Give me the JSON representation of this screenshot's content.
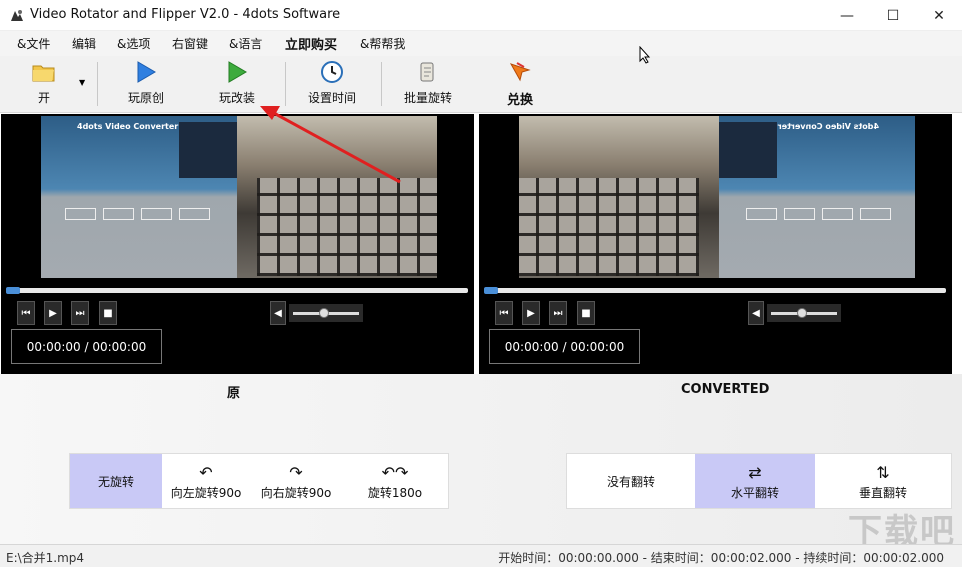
{
  "window": {
    "title": "Video Rotator and Flipper V2.0 - 4dots Software",
    "controls": {
      "minimize": "—",
      "maximize": "☐",
      "close": "✕"
    }
  },
  "menu": [
    {
      "label": "&文件"
    },
    {
      "label": "编辑"
    },
    {
      "label": "&选项"
    },
    {
      "label": "右窗键"
    },
    {
      "label": "&语言"
    },
    {
      "label": "立即购买"
    },
    {
      "label": "&帮帮我"
    }
  ],
  "toolbar": {
    "open_label": "开",
    "play_original_label": "玩原创",
    "play_converted_label": "玩改装",
    "set_time_label": "设置时间",
    "batch_rotate_label": "批量旋转",
    "convert_label": "兑换"
  },
  "players": {
    "original": {
      "time": "00:00:00 / 00:00:00",
      "caption": "原",
      "seek_progress": 0.0,
      "volume": 0.5
    },
    "converted": {
      "time": "00:00:00 / 00:00:00",
      "caption": "CONVERTED",
      "seek_progress": 0.0,
      "volume": 0.5
    }
  },
  "video_frame": {
    "app_title": "4dots Video Converter"
  },
  "rotation": {
    "options": [
      {
        "label": "无旋转",
        "icon": "none",
        "selected": true
      },
      {
        "label": "向左旋转90o",
        "icon": "rotate-left-icon",
        "selected": false
      },
      {
        "label": "向右旋转90o",
        "icon": "rotate-right-icon",
        "selected": false
      },
      {
        "label": "旋转180o",
        "icon": "rotate-180-icon",
        "selected": false
      }
    ]
  },
  "flip": {
    "options": [
      {
        "label": "没有翻转",
        "icon": "none",
        "selected": false
      },
      {
        "label": "水平翻转",
        "icon": "flip-horizontal-icon",
        "selected": true
      },
      {
        "label": "垂直翻转",
        "icon": "flip-vertical-icon",
        "selected": false
      }
    ]
  },
  "status": {
    "file": "E:\\合并1.mp4",
    "times": "开始时间：00:00:00.000 - 结束时间：00:00:02.000 - 持续时间：00:00:02.000"
  },
  "watermark": "下载吧",
  "colors": {
    "selected": "#c9c9f6",
    "play_blue": "#2f7fe0",
    "play_green": "#3dab3d",
    "annotation_red": "#e02020"
  }
}
